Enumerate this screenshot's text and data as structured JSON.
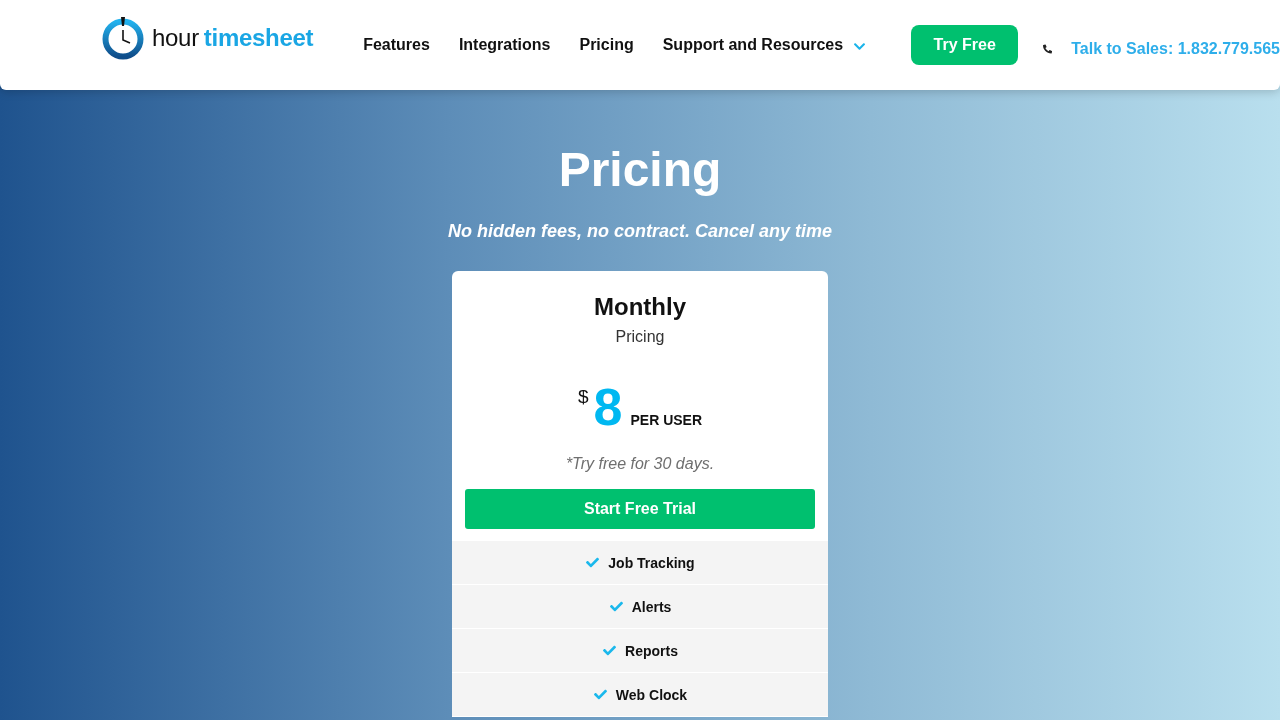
{
  "header": {
    "logo": {
      "word": "hour",
      "accent": "timesheet"
    },
    "nav": [
      {
        "label": "Features",
        "kind": "link"
      },
      {
        "label": "Integrations",
        "kind": "link"
      },
      {
        "label": "Pricing",
        "kind": "link"
      },
      {
        "label": "Support and Resources",
        "kind": "dropdown"
      }
    ],
    "cta": "Try Free",
    "sales": "Talk to Sales: 1.832.779.565"
  },
  "hero": {
    "title": "Pricing",
    "subtitle": "No hidden fees, no contract. Cancel any time"
  },
  "plan": {
    "name": "Monthly",
    "subtitle": "Pricing",
    "currency": "$",
    "price": "8",
    "unit": "PER USER",
    "note": "*Try free for 30 days.",
    "button": "Start Free Trial",
    "features": [
      "Job Tracking",
      "Alerts",
      "Reports",
      "Web Clock"
    ]
  }
}
